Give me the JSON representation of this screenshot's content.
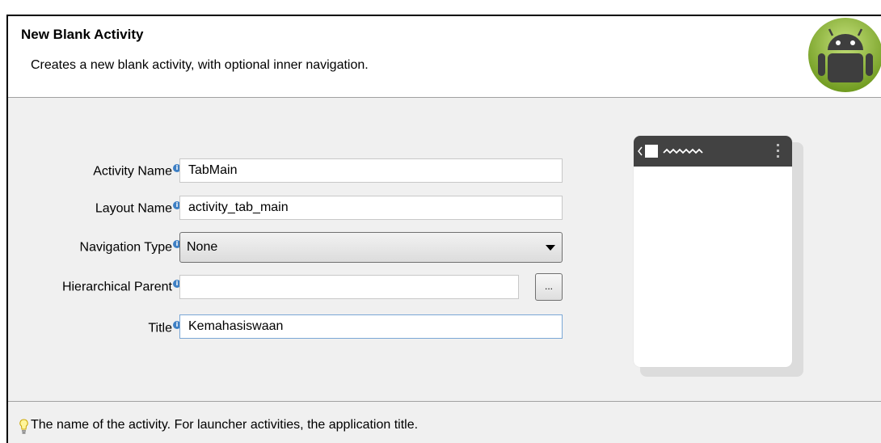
{
  "header": {
    "title": "New Blank Activity",
    "description": "Creates a new blank activity, with optional inner navigation.",
    "logo_icon": "android-logo-icon"
  },
  "form": {
    "activity_name": {
      "label": "Activity Name",
      "value": "TabMain"
    },
    "layout_name": {
      "label": "Layout Name",
      "value": "activity_tab_main"
    },
    "navigation_type": {
      "label": "Navigation Type",
      "value": "None"
    },
    "hierarchical_parent": {
      "label": "Hierarchical Parent",
      "value": "",
      "browse_label": "..."
    },
    "title": {
      "label": "Title",
      "value": "Kemahasiswaan"
    },
    "info_icon": "i"
  },
  "preview": {
    "bar_color": "#424242"
  },
  "footer": {
    "hint": "The name of the activity. For launcher activities, the application title.",
    "hint_icon": "lightbulb-icon"
  },
  "colors": {
    "accent": "#a4c639",
    "info": "#3d7fc4"
  }
}
